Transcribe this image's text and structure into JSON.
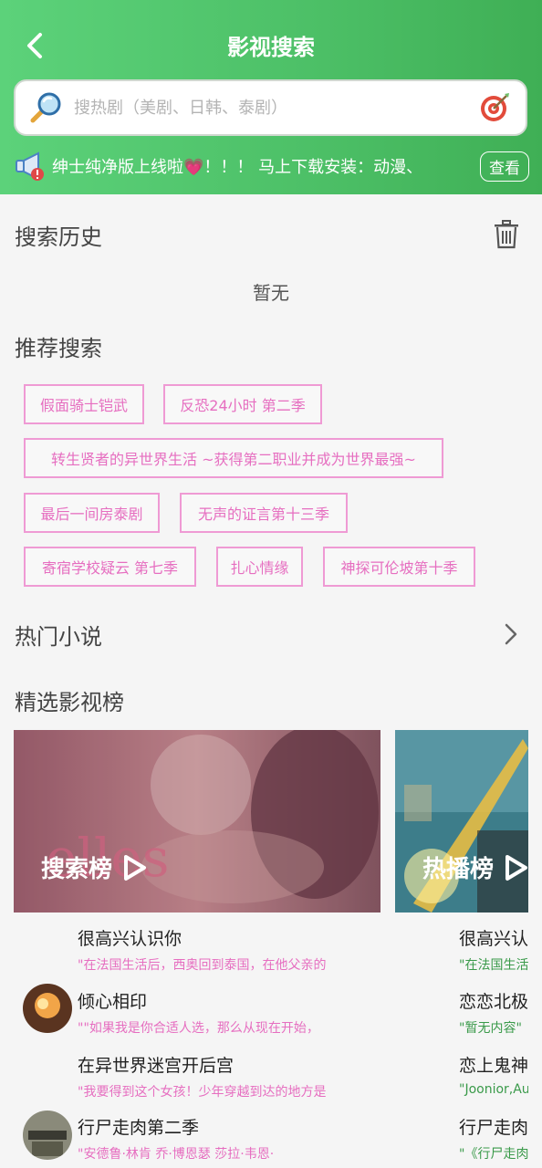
{
  "header": {
    "title": "影视搜索",
    "search_placeholder": "搜热剧（美剧、日韩、泰剧）",
    "notice_text": "绅士纯净版上线啦💗！！！ 马上下载安装：动漫、",
    "view_label": "查看",
    "colors": {
      "gradient_start": "#5cd27a",
      "gradient_end": "#3faf55"
    }
  },
  "history": {
    "title": "搜索历史",
    "empty": "暂无"
  },
  "recommend": {
    "title": "推荐搜索",
    "tags": [
      "假面骑士铠武",
      "反恐24小时 第二季",
      "转生贤者的异世界生活 ~获得第二职业并成为世界最强~",
      "最后一间房泰剧",
      "无声的证言第十三季",
      "寄宿学校疑云 第七季",
      "扎心情缘",
      "神探可伦坡第十季"
    ],
    "tag_color": "#e66ec0"
  },
  "novels": {
    "title": "热门小说"
  },
  "rankings": {
    "title": "精选影视榜",
    "cards": [
      {
        "label": "搜索榜"
      },
      {
        "label": "热播榜"
      }
    ],
    "search_list": [
      {
        "title": "很高兴认识你",
        "desc": "\"在法国生活后，西奥回到泰国，在他父亲的"
      },
      {
        "title": "倾心相印",
        "desc": "\"\"如果我是你合适人选，那么从现在开始，"
      },
      {
        "title": "在异世界迷宫开后宫",
        "desc": "\"我要得到这个女孩！少年穿越到达的地方是"
      },
      {
        "title": "行尸走肉第二季",
        "desc": "\"安德鲁·林肯 乔·博恩瑟 莎拉·韦恩·"
      }
    ],
    "hot_list": [
      {
        "title": "很高兴认",
        "desc": "\"在法国生活"
      },
      {
        "title": "恋恋北极",
        "desc": "\"暂无内容\""
      },
      {
        "title": "恋上鬼神",
        "desc": "\"Joonior,Au"
      },
      {
        "title": "行尸走肉",
        "desc": "\"《行尸走肉"
      }
    ],
    "search_desc_color": "#e66ec0",
    "hot_desc_color": "#3a9a4a"
  },
  "icons": [
    "chevron-left-icon",
    "search-icon",
    "target-icon",
    "megaphone-icon",
    "trash-icon",
    "chevron-right-icon",
    "play-icon"
  ]
}
